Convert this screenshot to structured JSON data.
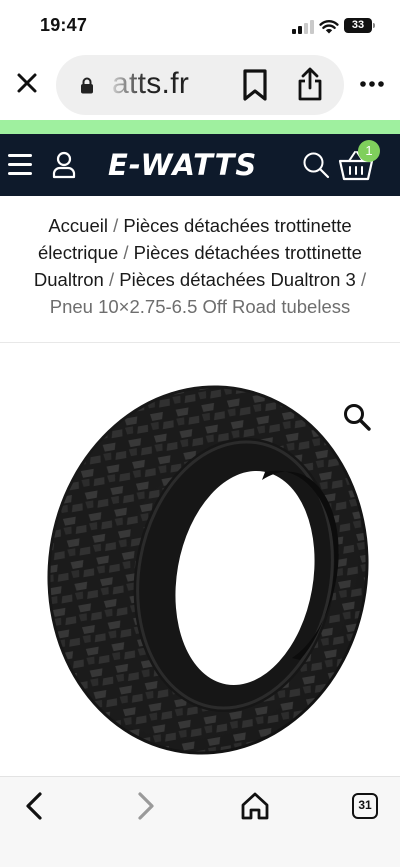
{
  "status_bar": {
    "time": "19:47",
    "battery": "33"
  },
  "browser": {
    "url": "atts.fr",
    "icons": {
      "close": "close-icon",
      "lock": "lock-icon",
      "bookmark": "bookmark-icon",
      "share": "share-icon",
      "more": "more-icon"
    }
  },
  "site": {
    "logo": "E-WATTS",
    "cart_count": "1",
    "colors": {
      "header_bg": "#0e1a2b",
      "accent_green": "#9ff09f",
      "badge_green": "#7fcf5c"
    }
  },
  "breadcrumb": {
    "items": [
      "Accueil",
      "Pièces détachées trottinette électrique",
      "Pièces détachées trottinette Dualtron",
      "Pièces détachées Dualtron 3"
    ],
    "separator": "/",
    "current": "Pneu 10×2.75-6.5 Off Road tubeless"
  },
  "product": {
    "watermark": "E-WATTS"
  },
  "bottom_nav": {
    "tabs_count": "31"
  }
}
